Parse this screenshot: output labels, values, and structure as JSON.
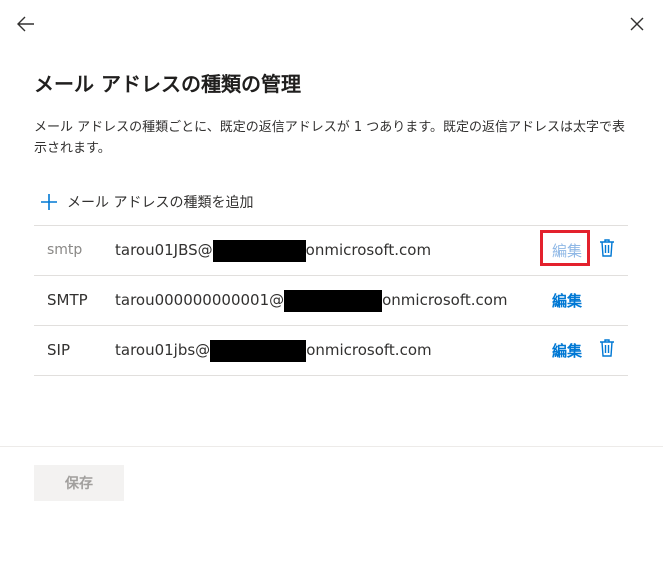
{
  "panel": {
    "title": "メール アドレスの種類の管理",
    "description": "メール アドレスの種類ごとに、既定の返信アドレスが 1 つあります。既定の返信アドレスは太字で表示されます。",
    "add_label": "メール アドレスの種類を追加"
  },
  "addresses": [
    {
      "type": "smtp",
      "prefix": "tarou01JBS@",
      "suffix": "onmicrosoft.com",
      "edit_label": "編集",
      "is_default": false,
      "has_delete": true
    },
    {
      "type": "SMTP",
      "prefix": "tarou000000000001@",
      "suffix": "onmicrosoft.com",
      "edit_label": "編集",
      "is_default": true,
      "has_delete": false
    },
    {
      "type": "SIP",
      "prefix": "tarou01jbs@",
      "suffix": "onmicrosoft.com",
      "edit_label": "編集",
      "is_default": true,
      "has_delete": true
    }
  ],
  "footer": {
    "save_label": "保存"
  },
  "colors": {
    "accent": "#0078d4",
    "highlight": "#e3212d",
    "text": "#323130",
    "disabled_text": "#a19f9d"
  },
  "icons": {
    "back": "arrow-left-icon",
    "close": "close-icon",
    "add": "plus-icon",
    "delete": "trash-icon"
  }
}
